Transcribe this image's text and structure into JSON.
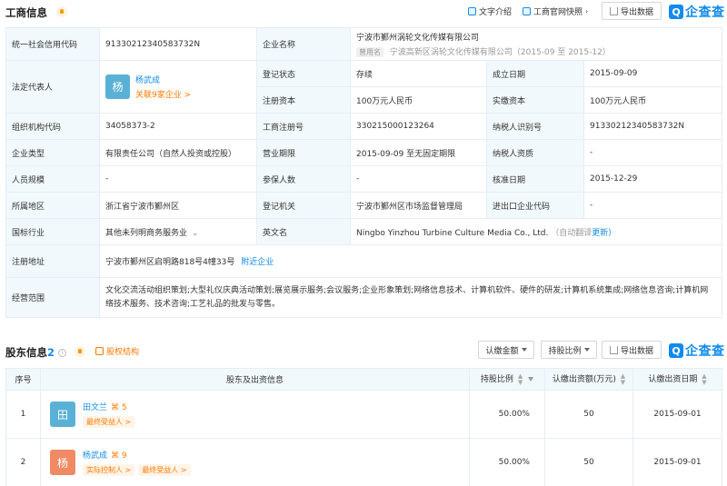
{
  "business": {
    "title": "工商信息",
    "text_intro": "文字介绍",
    "official_snapshot": "工商官网快照",
    "export": "导出数据",
    "logo_text": "企查查",
    "logo_mark": "Q",
    "rows": {
      "credit_code_label": "统一社会信用代码",
      "credit_code": "91330212340583732N",
      "company_name_label": "企业名称",
      "company_name": "宁波市鄞州涡轮文化传媒有限公司",
      "former_tag": "曾用名",
      "former_name": "宁波高新区涡轮文化传媒有限公司（2015-09 至 2015-12）",
      "legal_rep_label": "法定代表人",
      "legal_rep_avatar": "杨",
      "legal_rep_name": "杨武成",
      "legal_rep_related": "关联9家企业 >",
      "reg_status_label": "登记状态",
      "reg_status": "存续",
      "est_date_label": "成立日期",
      "est_date": "2015-09-09",
      "reg_capital_label": "注册资本",
      "reg_capital": "100万元人民币",
      "paid_capital_label": "实缴资本",
      "paid_capital": "100万元人民币",
      "org_code_label": "组织机构代码",
      "org_code": "34058373-2",
      "reg_no_label": "工商注册号",
      "reg_no": "330215000123264",
      "taxpayer_id_label": "纳税人识别号",
      "taxpayer_id": "91330212340583732N",
      "ent_type_label": "企业类型",
      "ent_type": "有限责任公司（自然人投资或控股）",
      "biz_term_label": "营业期限",
      "biz_term": "2015-09-09 至无固定期限",
      "taxpayer_qual_label": "纳税人资质",
      "taxpayer_qual": "-",
      "staff_label": "人员规模",
      "staff": "-",
      "insured_label": "参保人数",
      "insured": "-",
      "approve_date_label": "核准日期",
      "approve_date": "2015-12-29",
      "region_label": "所属地区",
      "region": "浙江省宁波市鄞州区",
      "authority_label": "登记机关",
      "authority": "宁波市鄞州区市场监督管理局",
      "ie_code_label": "进出口企业代码",
      "ie_code": "-",
      "industry_label": "国标行业",
      "industry": "其他未列明商务服务业",
      "en_name_label": "英文名",
      "en_name": "Ningbo Yinzhou Turbine Culture Media Co., Ltd.",
      "en_auto": "（自动翻译",
      "en_update": "更新）",
      "address_label": "注册地址",
      "address": "宁波市鄞州区启明路818号4幢33号",
      "nearby": "附近企业",
      "scope_label": "经营范围",
      "scope": "文化交流活动组织策划;大型礼仪庆典活动策划;展览展示服务;会议服务;企业形象策划;网络信息技术、计算机软件、硬件的研发;计算机系统集成;网络信息咨询;计算机网络技术服务、技术咨询;工艺礼品的批发与零售。"
    }
  },
  "shareholders": {
    "title": "股东信息",
    "count": "2",
    "equity_link": "股权结构",
    "filter_amount": "认缴金额",
    "filter_ratio": "持股比例",
    "export": "导出数据",
    "logo_text": "企查查",
    "logo_mark": "Q",
    "headers": {
      "seq": "序号",
      "info": "股东及出资信息",
      "ratio": "持股比例",
      "amount": "认缴出资额(万元)",
      "date": "认缴出资日期"
    },
    "rows": [
      {
        "seq": "1",
        "avatar": "田",
        "avatar_color": "#5ab1d6",
        "name": "田文兰",
        "related": "5",
        "tags": [
          "最终受益人 >"
        ],
        "ratio": "50.00%",
        "amount": "50",
        "date": "2015-09-01"
      },
      {
        "seq": "2",
        "avatar": "杨",
        "avatar_color": "#ef8a63",
        "name": "杨武成",
        "related": "9",
        "tags": [
          "实际控制人 >",
          "最终受益人 >"
        ],
        "ratio": "50.00%",
        "amount": "50",
        "date": "2015-09-01"
      }
    ]
  },
  "colors": {
    "accent": "#128bed",
    "orange": "#ff7a00",
    "label_bg": "#f2f9fc"
  }
}
